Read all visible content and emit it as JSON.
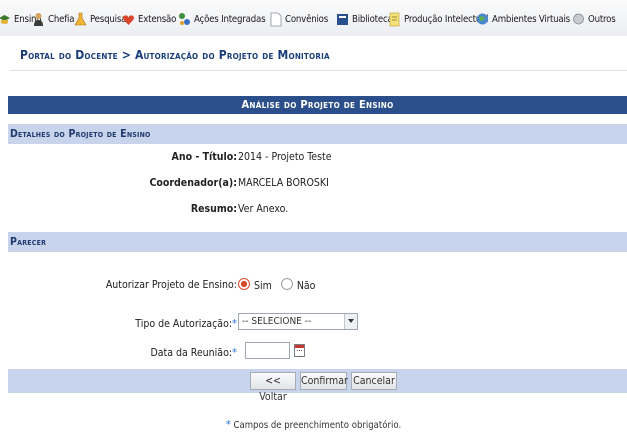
{
  "menu": [
    {
      "label": "Ensino",
      "icon": "graduation-icon"
    },
    {
      "label": "Chefia",
      "icon": "person-icon"
    },
    {
      "label": "Pesquisa",
      "icon": "flask-icon"
    },
    {
      "label": "Extensão",
      "icon": "heart-icon"
    },
    {
      "label": "Ações Integradas",
      "icon": "network-icon"
    },
    {
      "label": "Convênios",
      "icon": "document-icon"
    },
    {
      "label": "Biblioteca",
      "icon": "book-icon"
    },
    {
      "label": "Produção Intelectual",
      "icon": "notepad-icon"
    },
    {
      "label": "Ambientes Virtuais",
      "icon": "globe-icon"
    },
    {
      "label": "Outros",
      "icon": "misc-icon"
    }
  ],
  "breadcrumb": "Portal do Docente > Autorização do Projeto de Monitoria",
  "panel_title": "Análise do Projeto de Ensino",
  "details": {
    "heading": "Detalhes do Projeto de Ensino",
    "ano_titulo_label": "Ano - Título:",
    "ano_titulo_value": "2014 - Projeto Teste",
    "coordenador_label": "Coordenador(a):",
    "coordenador_value": "MARCELA BOROSKI",
    "resumo_label": "Resumo:",
    "resumo_value": "Ver Anexo."
  },
  "parecer": {
    "heading": "Parecer",
    "autorizar_label": "Autorizar Projeto de Ensino:",
    "option_sim": "Sim",
    "option_nao": "Não",
    "selected": "Sim",
    "tipo_label": "Tipo de Autorização:",
    "tipo_value": "-- SELECIONE --",
    "data_label": "Data da Reunião:",
    "data_value": "",
    "required_mark": "*"
  },
  "buttons": {
    "voltar": "<< Voltar",
    "confirmar": "Confirmar",
    "cancelar": "Cancelar"
  },
  "footnote": {
    "mark": "*",
    "text": "Campos de preenchimento obrigatório."
  },
  "colors": {
    "accent": "#2b4f8a",
    "section": "#c8d4ec",
    "required": "#2b6fd6",
    "radio_selected": "#d24a2c"
  }
}
